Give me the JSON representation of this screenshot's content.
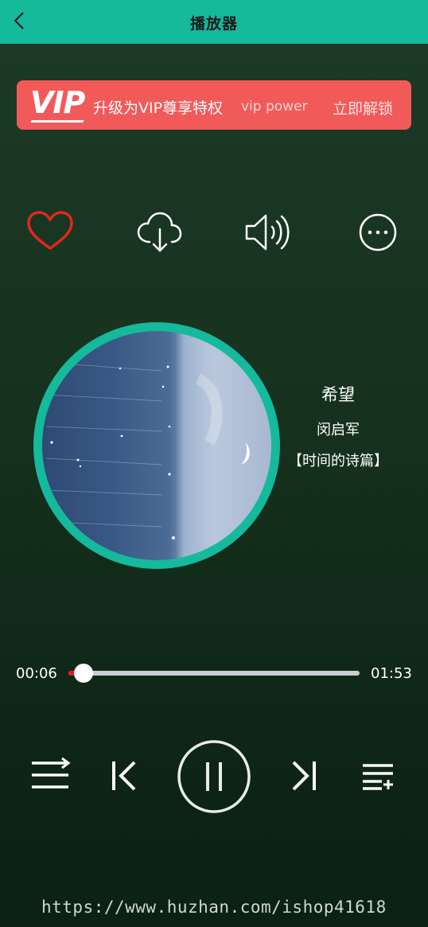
{
  "header": {
    "title": "播放器",
    "back_icon": "chevron-left-icon"
  },
  "vip_banner": {
    "logo": "VIP",
    "text": "升级为VIP尊享特权",
    "subtext": "vip power",
    "action": "立即解锁",
    "color": "#f25a5a"
  },
  "actions": [
    {
      "name": "favorite",
      "icon": "heart-icon",
      "color": "#e0281c"
    },
    {
      "name": "download",
      "icon": "cloud-download-icon"
    },
    {
      "name": "volume",
      "icon": "speaker-icon"
    },
    {
      "name": "more",
      "icon": "more-circle-icon"
    }
  ],
  "song": {
    "title": "希望",
    "artist": "闵启军",
    "album": "【时间的诗篇】"
  },
  "progress": {
    "current": "00:06",
    "total": "01:53",
    "fraction": 0.053
  },
  "controls": [
    {
      "name": "playlist-mode",
      "icon": "list-order-icon"
    },
    {
      "name": "previous",
      "icon": "skip-previous-icon"
    },
    {
      "name": "play-pause",
      "icon": "pause-icon"
    },
    {
      "name": "next",
      "icon": "skip-next-icon"
    },
    {
      "name": "queue",
      "icon": "queue-add-icon"
    }
  ],
  "colors": {
    "accent": "#15b99c",
    "progress": "#e11c1c"
  },
  "watermark": "https://www.huzhan.com/ishop41618"
}
